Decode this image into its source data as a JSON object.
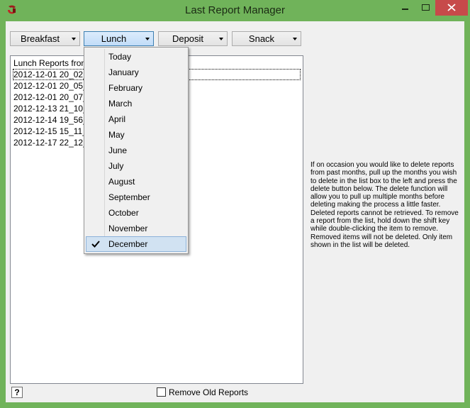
{
  "window": {
    "title": "Last Report Manager"
  },
  "toolbar": {
    "breakfast_label": "Breakfast",
    "lunch_label": "Lunch",
    "deposit_label": "Deposit",
    "snack_label": "Snack"
  },
  "list": {
    "header": "Lunch Reports fron",
    "rows": [
      "2012-12-01 20_02_3",
      "2012-12-01 20_05_5",
      "2012-12-01 20_07_0",
      "2012-12-13 21_10_3",
      "2012-12-14 19_56_0",
      "2012-12-15 15_11_0",
      "2012-12-17 22_12_3"
    ]
  },
  "menu": {
    "items": [
      "Today",
      "January",
      "February",
      "March",
      "April",
      "May",
      "June",
      "July",
      "August",
      "September",
      "October",
      "November",
      "December"
    ],
    "checked": "December"
  },
  "info": {
    "text": "If on occasion you would like to delete reports from past months, pull up the months you wish to delete in the list box to the left and press the delete button below. The delete function will allow you to pull up multiple months before deleting making the process a little faster. Deleted reports cannot be retrieved. To remove a report from the list, hold down the shift key while double-clicking the item to remove. Removed items will not be deleted. Only item shown in the list will be deleted."
  },
  "footer": {
    "help_label": "?",
    "checkbox_label": "Remove Old Reports"
  },
  "colors": {
    "titlebar": "#70b35a",
    "close": "#c74a4a",
    "selection": "#d1e2f2",
    "accent": "#3c7fb1"
  }
}
